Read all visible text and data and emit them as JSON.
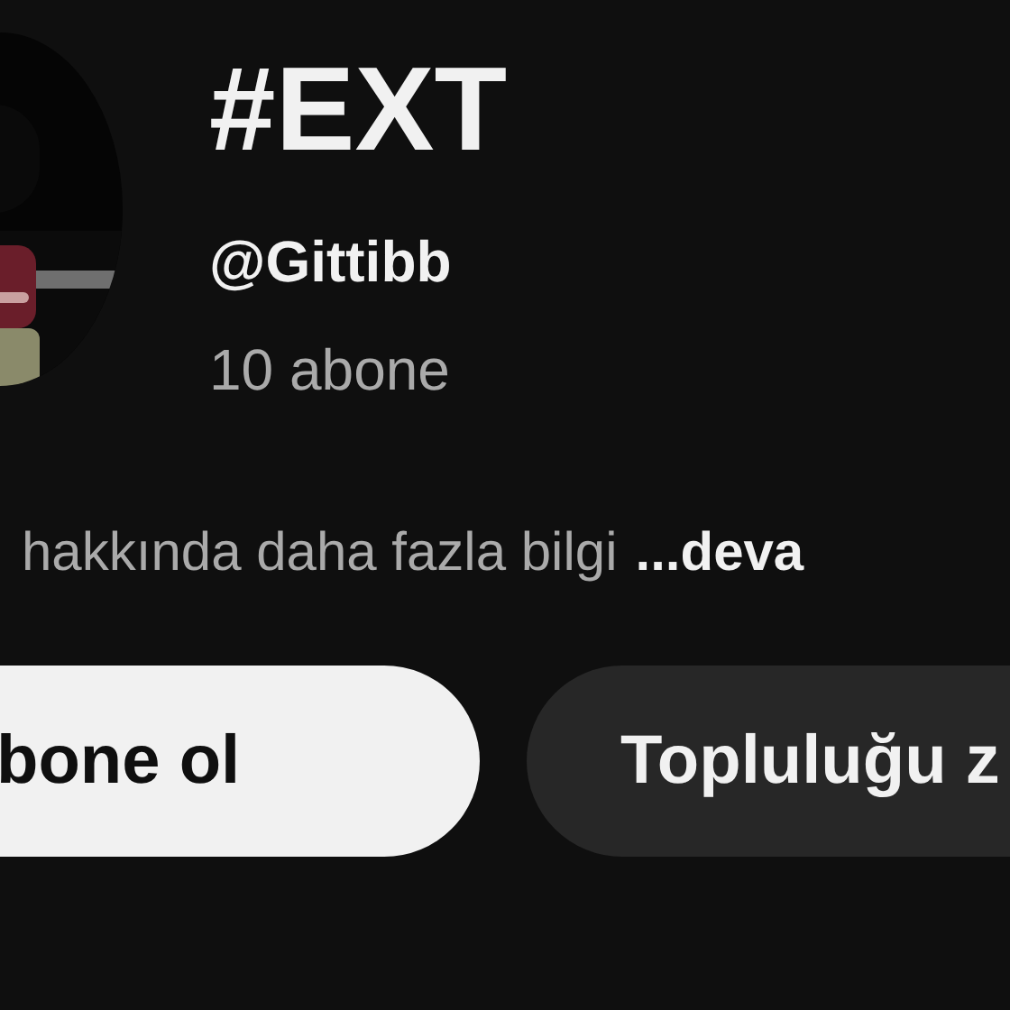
{
  "channel": {
    "name": "#EXT",
    "handle": "@Gittibb",
    "subscribers": "10 abone"
  },
  "description": {
    "text": "hakkında daha fazla bilgi",
    "more": "...deva"
  },
  "buttons": [
    {
      "label": "bone ol",
      "kind": "primary"
    },
    {
      "label": "Topluluğu z",
      "kind": "secondary"
    }
  ]
}
